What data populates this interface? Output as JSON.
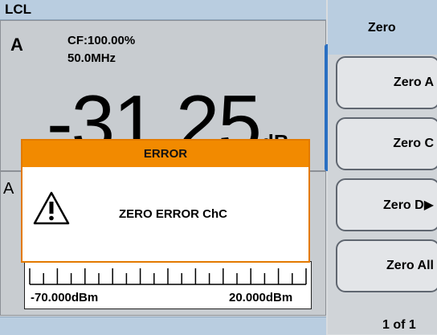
{
  "status": {
    "mode": "LCL"
  },
  "upper": {
    "channel": "A",
    "cf": "CF:100.00%",
    "frequency": "50.0MHz",
    "value": "-31.25",
    "unit": "dB"
  },
  "lower": {
    "channel": "A"
  },
  "meter": {
    "min_label": "-70.000dBm",
    "max_label": "20.000dBm"
  },
  "menu": {
    "title": "Zero",
    "items": [
      {
        "label": "Zero A"
      },
      {
        "label": "Zero C"
      },
      {
        "label": "Zero D▶"
      },
      {
        "label": "Zero All"
      }
    ],
    "page": "1 of 1"
  },
  "error": {
    "title": "ERROR",
    "message": "ZERO ERROR ChC"
  },
  "colors": {
    "accent": "#f28a00",
    "status_bar": "#b9cde0",
    "active_indicator": "#2a6fc2"
  }
}
